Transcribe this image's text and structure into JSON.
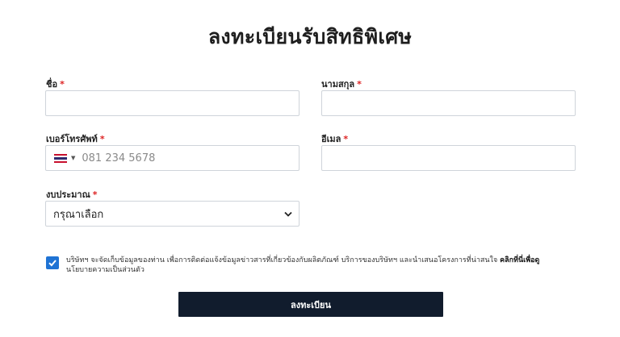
{
  "form": {
    "title": "ลงทะเบียนรับสิทธิพิเศษ",
    "required_mark": "*",
    "fields": {
      "first_name": {
        "label": "ชื่อ",
        "value": ""
      },
      "last_name": {
        "label": "นามสกุล",
        "value": ""
      },
      "phone": {
        "label": "เบอร์โทรศัพท์",
        "placeholder": "081 234 5678",
        "country": "TH",
        "country_icon": "thailand-flag-icon"
      },
      "email": {
        "label": "อีเมล",
        "value": ""
      },
      "budget": {
        "label": "งบประมาณ",
        "selected": "กรุณาเลือก"
      }
    },
    "consent": {
      "checked": true,
      "text": "บริษัทฯ จะจัดเก็บข้อมูลของท่าน เพื่อการติดต่อแจ้งข้อมูลข่าวสารที่เกี่ยวข้องกับผลิตภัณฑ์ บริการของบริษัทฯ และนำเสนอโครงการที่น่าสนใจ ",
      "link_text": "คลิกที่นี่เพื่อดู",
      "text_tail": "นโยบายความเป็นส่วนตัว"
    },
    "submit_label": "ลงทะเบียน"
  },
  "colors": {
    "required": "#dd2222",
    "checkbox": "#1f73d4",
    "button_bg": "#111c2d"
  }
}
